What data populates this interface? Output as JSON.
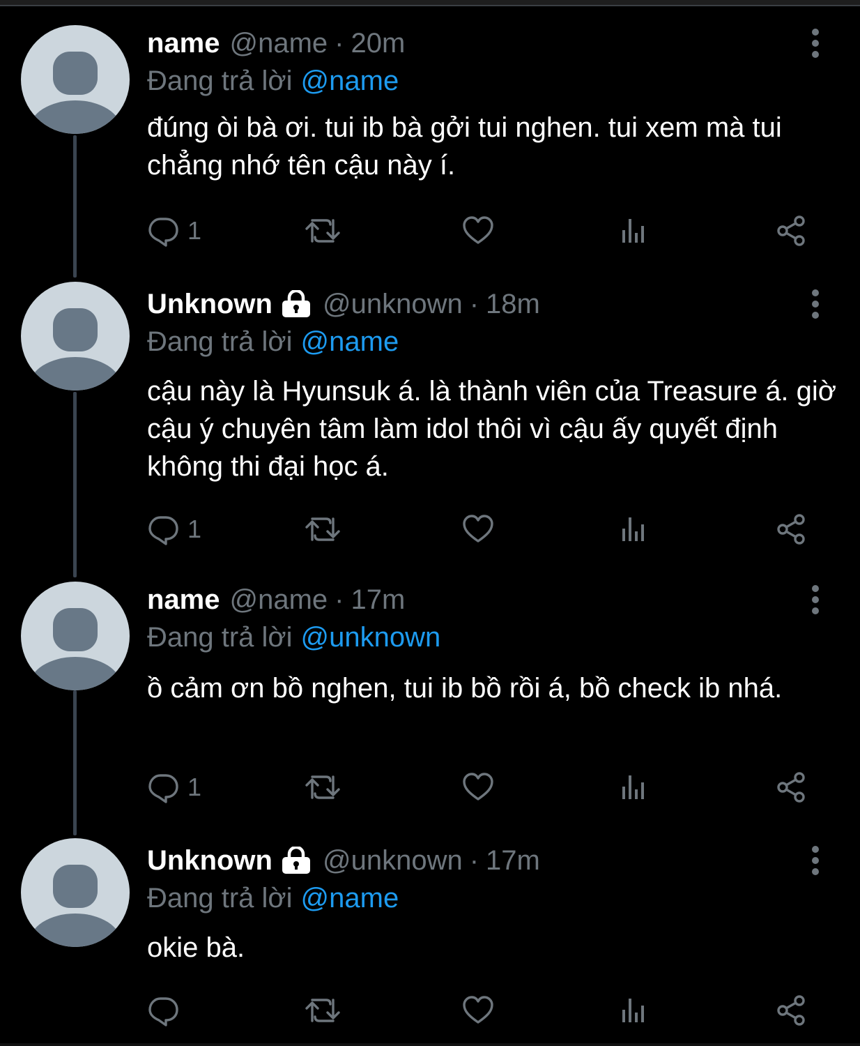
{
  "tweets": [
    {
      "display_name": "name",
      "locked": false,
      "handle": "@name",
      "separator": "·",
      "time": "20m",
      "reply_prefix": "Đang trả lời",
      "reply_to": "@name",
      "text": "đúng òi bà ơi. tui ib bà gởi tui nghen. tui xem mà tui chẳng nhớ tên cậu này í.",
      "reply_count": "1"
    },
    {
      "display_name": "Unknown",
      "locked": true,
      "handle": "@unknown",
      "separator": "·",
      "time": "18m",
      "reply_prefix": "Đang trả lời",
      "reply_to": "@name",
      "text": "cậu này là Hyunsuk á. là thành viên của Treasure á. giờ cậu ý chuyên tâm làm idol thôi vì cậu ấy quyết định không thi đại học á.",
      "reply_count": "1"
    },
    {
      "display_name": "name",
      "locked": false,
      "handle": "@name",
      "separator": "·",
      "time": "17m",
      "reply_prefix": "Đang trả lời",
      "reply_to": "@unknown",
      "text": "ồ  cảm ơn bồ nghen, tui ib bồ rồi á, bồ check ib nhá.",
      "reply_count": "1"
    },
    {
      "display_name": "Unknown",
      "locked": true,
      "handle": "@unknown",
      "separator": "·",
      "time": "17m",
      "reply_prefix": "Đang trả lời",
      "reply_to": "@name",
      "text": "okie bà.",
      "reply_count": ""
    }
  ],
  "icons": {
    "reply": "reply-icon",
    "retweet": "retweet-icon",
    "like": "heart-icon",
    "views": "bar-chart-icon",
    "share": "share-icon",
    "more": "more-vertical-icon",
    "lock": "lock-icon"
  },
  "colors": {
    "background": "#000000",
    "text": "#ffffff",
    "muted": "#6e767d",
    "accent": "#1d9bf0",
    "thread_line": "#3a4450",
    "avatar_bg": "#ccd6dd",
    "avatar_fg": "#687887"
  }
}
